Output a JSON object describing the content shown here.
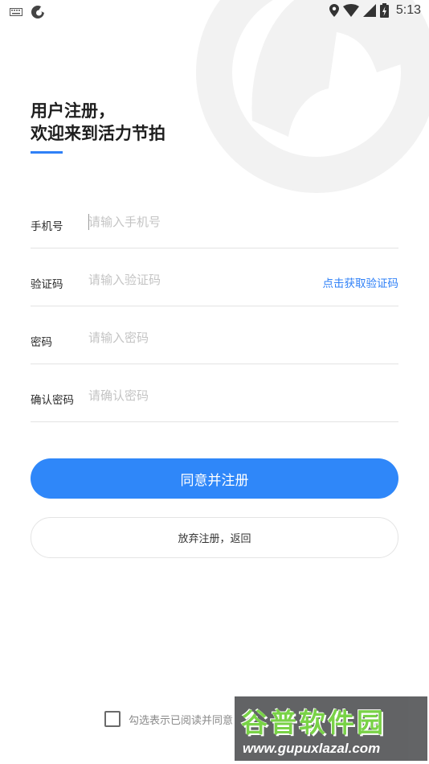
{
  "status_bar": {
    "time": "5:13",
    "icons": [
      "keyboard-icon",
      "sync-icon",
      "location-icon",
      "wifi-icon",
      "signal-icon",
      "battery-icon"
    ]
  },
  "header": {
    "line1": "用户注册，",
    "line2": "欢迎来到活力节拍"
  },
  "form": {
    "phone": {
      "label": "手机号",
      "placeholder": "请输入手机号"
    },
    "code": {
      "label": "验证码",
      "placeholder": "请输入验证码",
      "action": "点击获取验证码"
    },
    "password": {
      "label": "密码",
      "placeholder": "请输入密码"
    },
    "confirm": {
      "label": "确认密码",
      "placeholder": "请确认密码"
    }
  },
  "buttons": {
    "register": "同意并注册",
    "back": "放弃注册，返回"
  },
  "agreement": {
    "text": "勾选表示已阅读并同意",
    "checked": false
  },
  "watermark": {
    "title": "谷普软件园",
    "url": "www.gupuxlazal.com"
  },
  "colors": {
    "accent": "#2f87f9",
    "link": "#2f80f7",
    "watermark_green": "#6fcf3a"
  }
}
